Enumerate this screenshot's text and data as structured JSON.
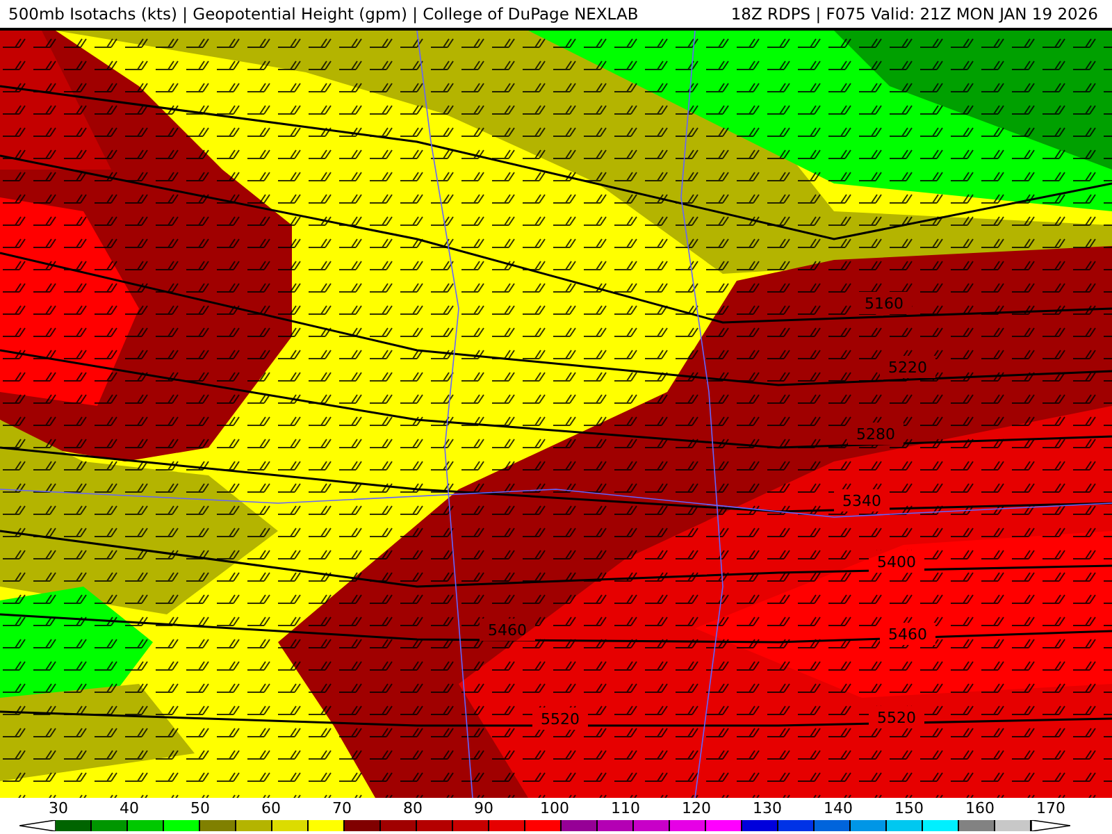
{
  "header": {
    "title": "500mb Isotachs (kts) | Geopotential Height (gpm) | College of DuPage NEXLAB",
    "run": "18Z RDPS | F075 Valid: 21Z MON JAN 19 2026"
  },
  "map": {
    "contour_labels": [
      {
        "text": "5160"
      },
      {
        "text": "5220"
      },
      {
        "text": "5280"
      },
      {
        "text": "5340"
      },
      {
        "text": "5400"
      },
      {
        "text": "5460"
      },
      {
        "text": "5460"
      },
      {
        "text": "5520"
      },
      {
        "text": "5520"
      }
    ]
  },
  "colorbar": {
    "ticks": [
      "30",
      "40",
      "50",
      "60",
      "70",
      "80",
      "90",
      "100",
      "110",
      "120",
      "130",
      "140",
      "150",
      "160",
      "170"
    ],
    "swatches": [
      {
        "color": "#006400"
      },
      {
        "color": "#009600"
      },
      {
        "color": "#00c800"
      },
      {
        "color": "#00ff00"
      },
      {
        "color": "#808000"
      },
      {
        "color": "#b4b400"
      },
      {
        "color": "#dcdc00"
      },
      {
        "color": "#ffff00"
      },
      {
        "color": "#800000"
      },
      {
        "color": "#a00000"
      },
      {
        "color": "#b40000"
      },
      {
        "color": "#c80000"
      },
      {
        "color": "#e60000"
      },
      {
        "color": "#ff0000"
      },
      {
        "color": "#960096"
      },
      {
        "color": "#b400b4"
      },
      {
        "color": "#c800c8"
      },
      {
        "color": "#e600e6"
      },
      {
        "color": "#ff00ff"
      },
      {
        "color": "#0000dc"
      },
      {
        "color": "#0032e6"
      },
      {
        "color": "#0064dc"
      },
      {
        "color": "#0096e6"
      },
      {
        "color": "#00c8f0"
      },
      {
        "color": "#00f0ff"
      },
      {
        "color": "#828282"
      },
      {
        "color": "#c8c8c8"
      }
    ]
  }
}
